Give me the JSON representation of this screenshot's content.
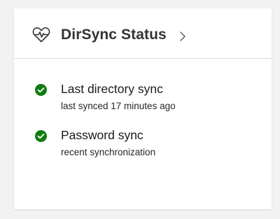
{
  "card": {
    "title": "DirSync Status",
    "icon": "heart-pulse-icon",
    "chevron_icon": "chevron-right-icon"
  },
  "items": [
    {
      "icon": "check-circle-icon",
      "title": "Last directory sync",
      "subtitle": "last synced 17 minutes ago"
    },
    {
      "icon": "check-circle-icon",
      "title": "Password sync",
      "subtitle": "recent synchronization"
    }
  ],
  "colors": {
    "success": "#107c10",
    "title_text": "#333333",
    "divider": "#dcdcdc",
    "background": "#f2f2f2",
    "card": "#ffffff"
  }
}
